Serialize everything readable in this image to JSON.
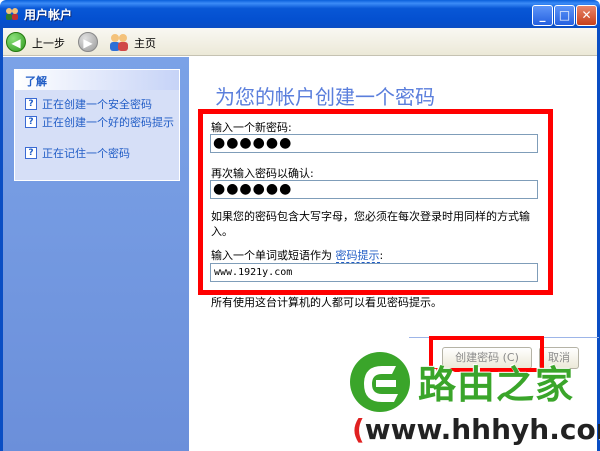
{
  "window": {
    "title": "用户帐户",
    "controls": {
      "minimize": "_",
      "maximize": "□",
      "close": "✕"
    }
  },
  "toolbar": {
    "back_label": "上一步",
    "back_icon": "back-arrow-icon",
    "forward_icon": "forward-arrow-icon",
    "home_label": "主页",
    "home_icon": "users-home-icon"
  },
  "sidebar": {
    "panel_title": "了解",
    "items": [
      {
        "label": "正在创建一个安全密码",
        "icon": "help-icon"
      },
      {
        "label": "正在创建一个好的密码提示",
        "icon": "help-icon"
      },
      {
        "label": "正在记住一个密码",
        "icon": "help-icon"
      }
    ]
  },
  "main": {
    "title": "为您的帐户创建一个密码",
    "new_password_label": "输入一个新密码:",
    "new_password_value": "●●●●●●",
    "confirm_password_label": "再次输入密码以确认:",
    "confirm_password_value": "●●●●●●",
    "case_note": "如果您的密码包含大写字母，您必须在每次登录时用同样的方式输入。",
    "hint_label": "输入一个单词或短语作为",
    "hint_link": "密码提示",
    "hint_colon": ":",
    "hint_value": "www.1921y.com",
    "visibility_note": "所有使用这台计算机的人都可以看见密码提示。",
    "create_button": "创建密码 (C)",
    "cancel_button": "取消"
  },
  "watermark": {
    "brand": "路由之家",
    "url_open": "(",
    "url": "www.hhhyh.com",
    "url_close": ")"
  },
  "colors": {
    "title_blue": "#0A4EC4",
    "sidebar_blue": "#7BA2E7",
    "link_blue": "#215DC6",
    "highlight_red": "#FF0000",
    "watermark_green": "#3AA52A"
  }
}
